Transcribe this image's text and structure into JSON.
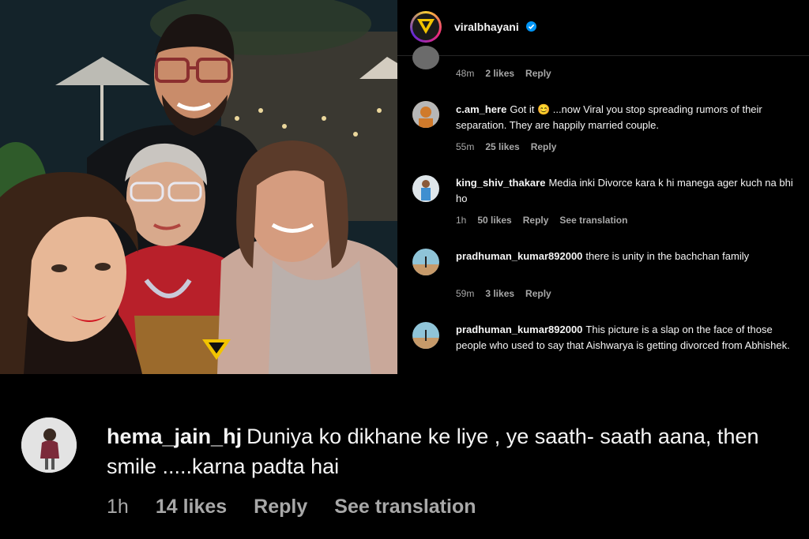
{
  "post": {
    "account_name": "viralbhayani",
    "verified": true,
    "accent_color": "#0095f6"
  },
  "comments": [
    {
      "username": "",
      "text": "",
      "time": "48m",
      "likes": "2 likes",
      "reply": "Reply",
      "avatar_icon": "avatar-icon"
    },
    {
      "username": "c.am_here",
      "text": "Got it 😊 ...now Viral you stop spreading rumors of their separation. They are happily married couple.",
      "time": "55m",
      "likes": "25 likes",
      "reply": "Reply",
      "avatar_icon": "avatar-icon"
    },
    {
      "username": "king_shiv_thakare",
      "text": "Media inki Divorce kara k hi manega ager kuch na bhi ho",
      "time": "1h",
      "likes": "50 likes",
      "reply": "Reply",
      "translate": "See translation",
      "avatar_icon": "avatar-icon"
    },
    {
      "username": "pradhuman_kumar892000",
      "text": "there is unity in the bachchan family",
      "time": "59m",
      "likes": "3 likes",
      "reply": "Reply",
      "avatar_icon": "avatar-icon"
    },
    {
      "username": "pradhuman_kumar892000",
      "text": "This picture is a slap on the face of those people who used to say that Aishwarya is getting divorced from Abhishek.",
      "avatar_icon": "avatar-icon"
    }
  ],
  "featured_comment": {
    "username": "hema_jain_hj",
    "text": "Duniya ko dikhane ke liye , ye saath- saath aana, then smile .....karna padta hai",
    "time": "1h",
    "likes": "14 likes",
    "reply": "Reply",
    "translate": "See translation"
  },
  "colors": {
    "background": "#000000",
    "text_primary": "#f5f5f5",
    "text_secondary": "#a8a8a8"
  }
}
